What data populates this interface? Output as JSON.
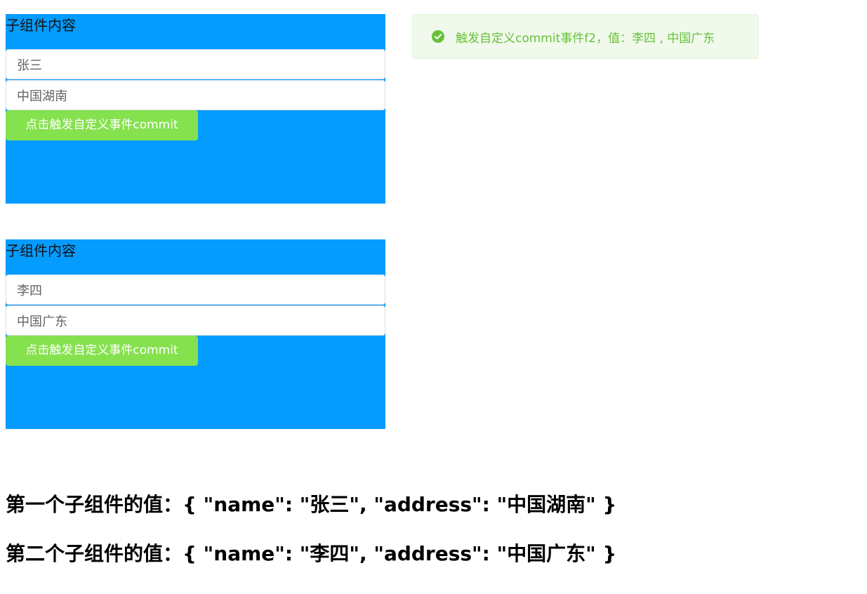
{
  "children": [
    {
      "title": "子组件内容",
      "name_value": "张三",
      "address_value": "中国湖南",
      "button_label": "点击触发自定义事件commit"
    },
    {
      "title": "子组件内容",
      "name_value": "李四",
      "address_value": "中国广东",
      "button_label": "点击触发自定义事件commit"
    }
  ],
  "toast": {
    "icon": "success-check-icon",
    "message": "触发自定义commit事件f2，值：李四 , 中国广东"
  },
  "results": {
    "first": "第一个子组件的值：{ \"name\": \"张三\", \"address\": \"中国湖南\" }",
    "second": "第二个子组件的值：{ \"name\": \"李四\", \"address\": \"中国广东\" }"
  },
  "colors": {
    "child_background": "#049cff",
    "button_background": "#85e14e",
    "toast_background": "#f0f9eb",
    "toast_text": "#67c23a"
  }
}
